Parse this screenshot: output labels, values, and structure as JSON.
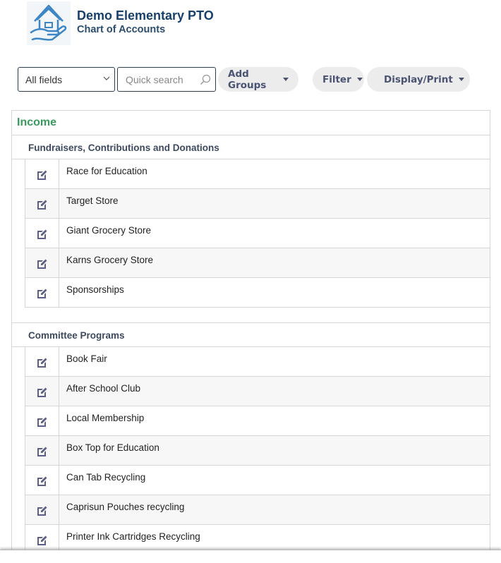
{
  "header": {
    "logo_icon": "house-in-hand-icon",
    "org_title": "Demo Elementary PTO",
    "page_subtitle": "Chart of Accounts"
  },
  "toolbar": {
    "field_select_value": "All fields",
    "search_placeholder": "Quick search",
    "search_value": "",
    "add_groups_label": "Add Groups",
    "filter_label": "Filter",
    "display_print_label": "Display/Print"
  },
  "colors": {
    "category": "#3a9a5e",
    "org_title": "#17406b",
    "pill_text": "#4a5372",
    "edit_icon": "#5b5f85"
  },
  "categories": [
    {
      "label": "Income",
      "groups": [
        {
          "label": "Fundraisers, Contributions and Donations",
          "accounts": [
            "Race for Education",
            "Target Store",
            "Giant Grocery Store",
            "Karns Grocery Store",
            "Sponsorships"
          ]
        },
        {
          "label": "Committee Programs",
          "accounts": [
            "Book Fair",
            "After School Club",
            "Local Membership",
            "Box Top for Education",
            "Can Tab Recycling",
            "Caprisun Pouches recycling",
            "Printer Ink Cartridges Recycling"
          ]
        }
      ]
    }
  ]
}
